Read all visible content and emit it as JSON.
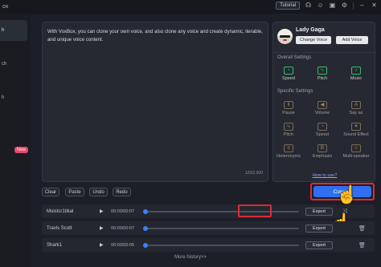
{
  "titlebar": {
    "app_name": "ox",
    "tutorial": "Tutorial",
    "icons": [
      "headset-icon",
      "user-icon",
      "gift-icon",
      "gear-icon",
      "minimize-icon",
      "close-icon"
    ]
  },
  "sidebar": {
    "items": [
      {
        "label": "h"
      },
      {
        "label": "ch"
      },
      {
        "label": ""
      },
      {
        "label": "h"
      }
    ],
    "new_badge": "New"
  },
  "editor": {
    "text": "With VoxBox, you can clone your own voice, and also clone any voice and create dynamic, iterable, and unique voice content.",
    "counter": "123/2,000"
  },
  "voice_panel": {
    "voice_name": "Lady Gaga",
    "change_voice": "Change Voice",
    "add_voice": "Add Voice",
    "overall_title": "Overall Settings",
    "overall": [
      {
        "label": "Speed"
      },
      {
        "label": "Pitch"
      },
      {
        "label": "Music"
      }
    ],
    "specific_title": "Specific Settings",
    "specific": [
      {
        "label": "Pause"
      },
      {
        "label": "Volume"
      },
      {
        "label": "Say as"
      },
      {
        "label": "Pitch"
      },
      {
        "label": "Speed"
      },
      {
        "label": "Sound Effect"
      },
      {
        "label": "Heteronyms"
      },
      {
        "label": "Emphasis"
      },
      {
        "label": "Multi-speaker"
      }
    ],
    "how_to_use": "How to use?"
  },
  "actions": {
    "clear": "Clear",
    "paste": "Paste",
    "undo": "Undo",
    "redo": "Redo",
    "convert": "Convert"
  },
  "rows": [
    {
      "name": "Moistcr1tikal",
      "time": "00:00/00:07",
      "export": "Export",
      "progress": 0
    },
    {
      "name": "Travis Scott",
      "time": "00:00/00:07",
      "export": "Export",
      "progress": 0
    },
    {
      "name": "Shark1",
      "time": "00:00/00:05",
      "export": "Export",
      "progress": 0
    }
  ],
  "more_history": "More history>>",
  "colors": {
    "accent": "#2f6ff0",
    "highlight": "#e0283a",
    "active_setting": "#2ec06a",
    "new_badge": "#e8486a"
  }
}
